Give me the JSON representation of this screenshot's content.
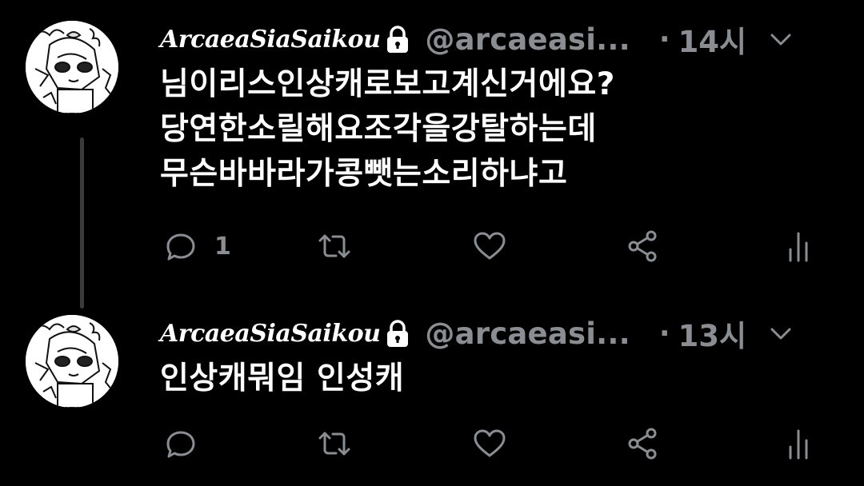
{
  "colors": {
    "background": "#000000",
    "text": "#ffffff",
    "secondary": "#8a8d91",
    "thread_line": "#3a3a3a"
  },
  "tweets": [
    {
      "display_name": "ArcaeaSiaSaikou",
      "handle": "@arcaeasi...",
      "separator": "·",
      "time": "14시",
      "text": "님이리스인상캐로보고계신거에요?\n당연한소릴해요조각을강탈하는데\n무슨바바라가콩뺏는소리하냐고",
      "reply_count": "1",
      "icons": [
        "lock-icon",
        "chevron-down-icon",
        "reply-icon",
        "retweet-icon",
        "like-icon",
        "share-icon",
        "analytics-icon"
      ]
    },
    {
      "display_name": "ArcaeaSiaSaikou",
      "handle": "@arcaeasi...",
      "separator": "·",
      "time": "13시",
      "text": "인상캐뭐임 인성캐",
      "reply_count": "",
      "icons": [
        "lock-icon",
        "chevron-down-icon",
        "reply-icon",
        "retweet-icon",
        "like-icon",
        "share-icon",
        "analytics-icon"
      ]
    }
  ]
}
